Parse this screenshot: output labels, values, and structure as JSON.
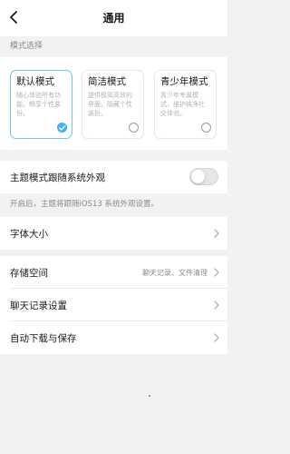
{
  "header": {
    "title": "通用",
    "back_icon": "chevron-left-icon"
  },
  "mode_section": {
    "label": "模式选择",
    "cards": [
      {
        "title": "默认模式",
        "desc": "随心体验所有功能，畅享个性装扮。",
        "selected": true
      },
      {
        "title": "简洁模式",
        "desc": "提供极简高效的界面，隐藏个性装扮。",
        "selected": false
      },
      {
        "title": "青少年模式",
        "desc": "青少年专属模式，维护纯净社交体验。",
        "selected": false
      }
    ],
    "accent_color": "#3fb4f0"
  },
  "theme_follow": {
    "label": "主题模式跟随系统外观",
    "enabled": false,
    "hint": "开启后，主题将跟随iOS13 系统外观设置。"
  },
  "settings": [
    {
      "label": "字体大小",
      "value": ""
    },
    {
      "label": "存储空间",
      "value": "聊天记录、文件清理"
    },
    {
      "label": "聊天记录设置",
      "value": ""
    },
    {
      "label": "自动下载与保存",
      "value": ""
    }
  ]
}
